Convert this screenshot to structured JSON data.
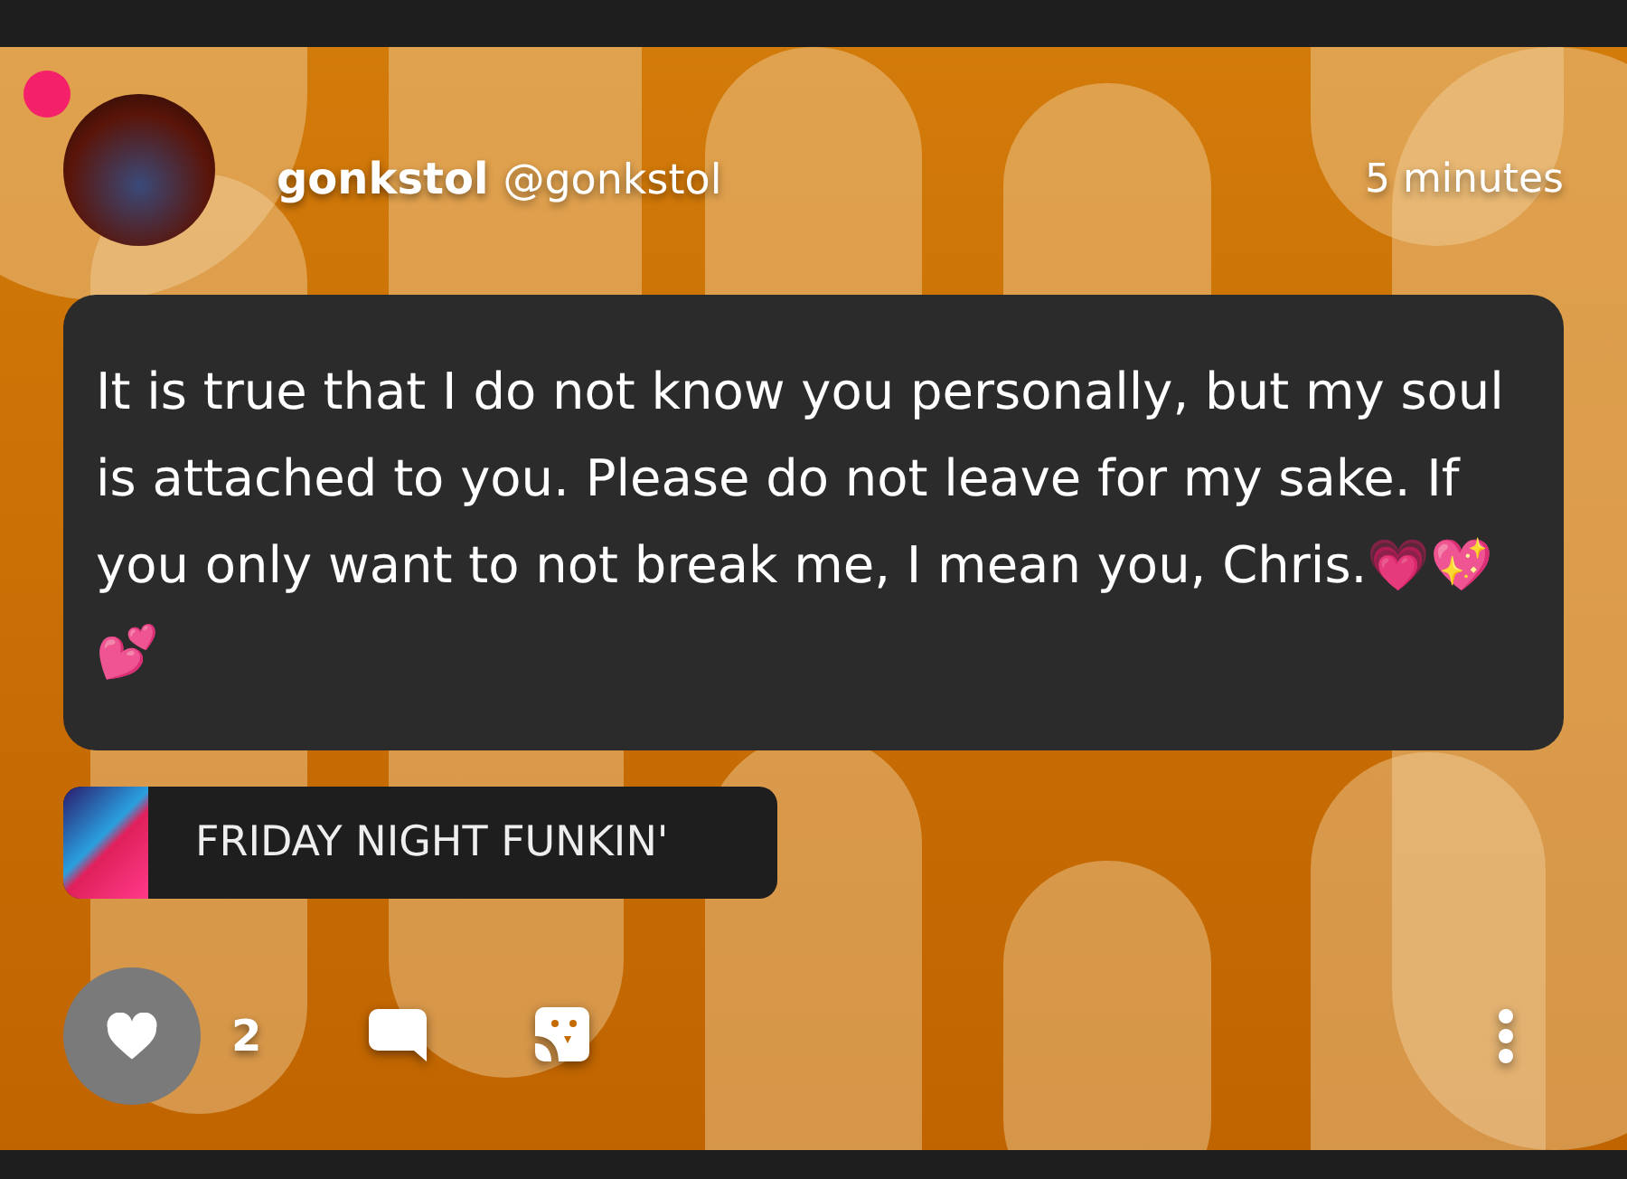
{
  "post": {
    "author_name": "gonkstol",
    "author_handle": "@gonkstol",
    "time": "5 minutes",
    "body": "It is true that I do not know you personally, but my soul is attached to you. Please do not leave for my sake. If you only want to not break me, I mean you, Chris.💗💖💕"
  },
  "tag": {
    "label": "FRIDAY NIGHT FUNKIN'"
  },
  "actions": {
    "like_count": "2"
  }
}
